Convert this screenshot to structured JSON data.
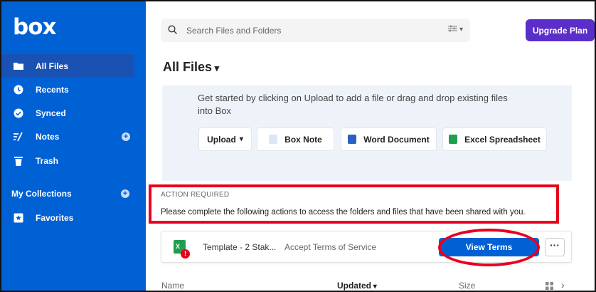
{
  "app": {
    "logo": "box"
  },
  "sidebar": {
    "items": [
      {
        "label": "All Files",
        "icon": "folder-icon",
        "active": true
      },
      {
        "label": "Recents",
        "icon": "clock-icon"
      },
      {
        "label": "Synced",
        "icon": "check-circle-icon"
      },
      {
        "label": "Notes",
        "icon": "notes-icon"
      },
      {
        "label": "Trash",
        "icon": "trash-icon"
      }
    ],
    "collections_title": "My Collections",
    "favorites_label": "Favorites"
  },
  "header": {
    "search_placeholder": "Search Files and Folders",
    "upgrade_label": "Upgrade Plan"
  },
  "page": {
    "title": "All Files",
    "empty_state_text": "Get started by clicking on Upload to add a file or drag and drop existing files into Box",
    "buttons": {
      "upload": "Upload",
      "box_note": "Box Note",
      "word_document": "Word Document",
      "excel_spreadsheet": "Excel Spreadsheet"
    }
  },
  "action_required": {
    "title": "ACTION REQUIRED",
    "message": "Please complete the following actions to access the folders and files that have been shared with you."
  },
  "pending_item": {
    "file_name": "Template - 2 Stak...",
    "action_text": "Accept Terms of Service",
    "button_label": "View Terms",
    "more_label": "···"
  },
  "table_header": {
    "name": "Name",
    "updated": "Updated",
    "size": "Size"
  },
  "colors": {
    "sidebar": "#0061d5",
    "upgrade": "#5b2ec9",
    "primary_button": "#0061d5",
    "highlight": "#e8001d"
  }
}
